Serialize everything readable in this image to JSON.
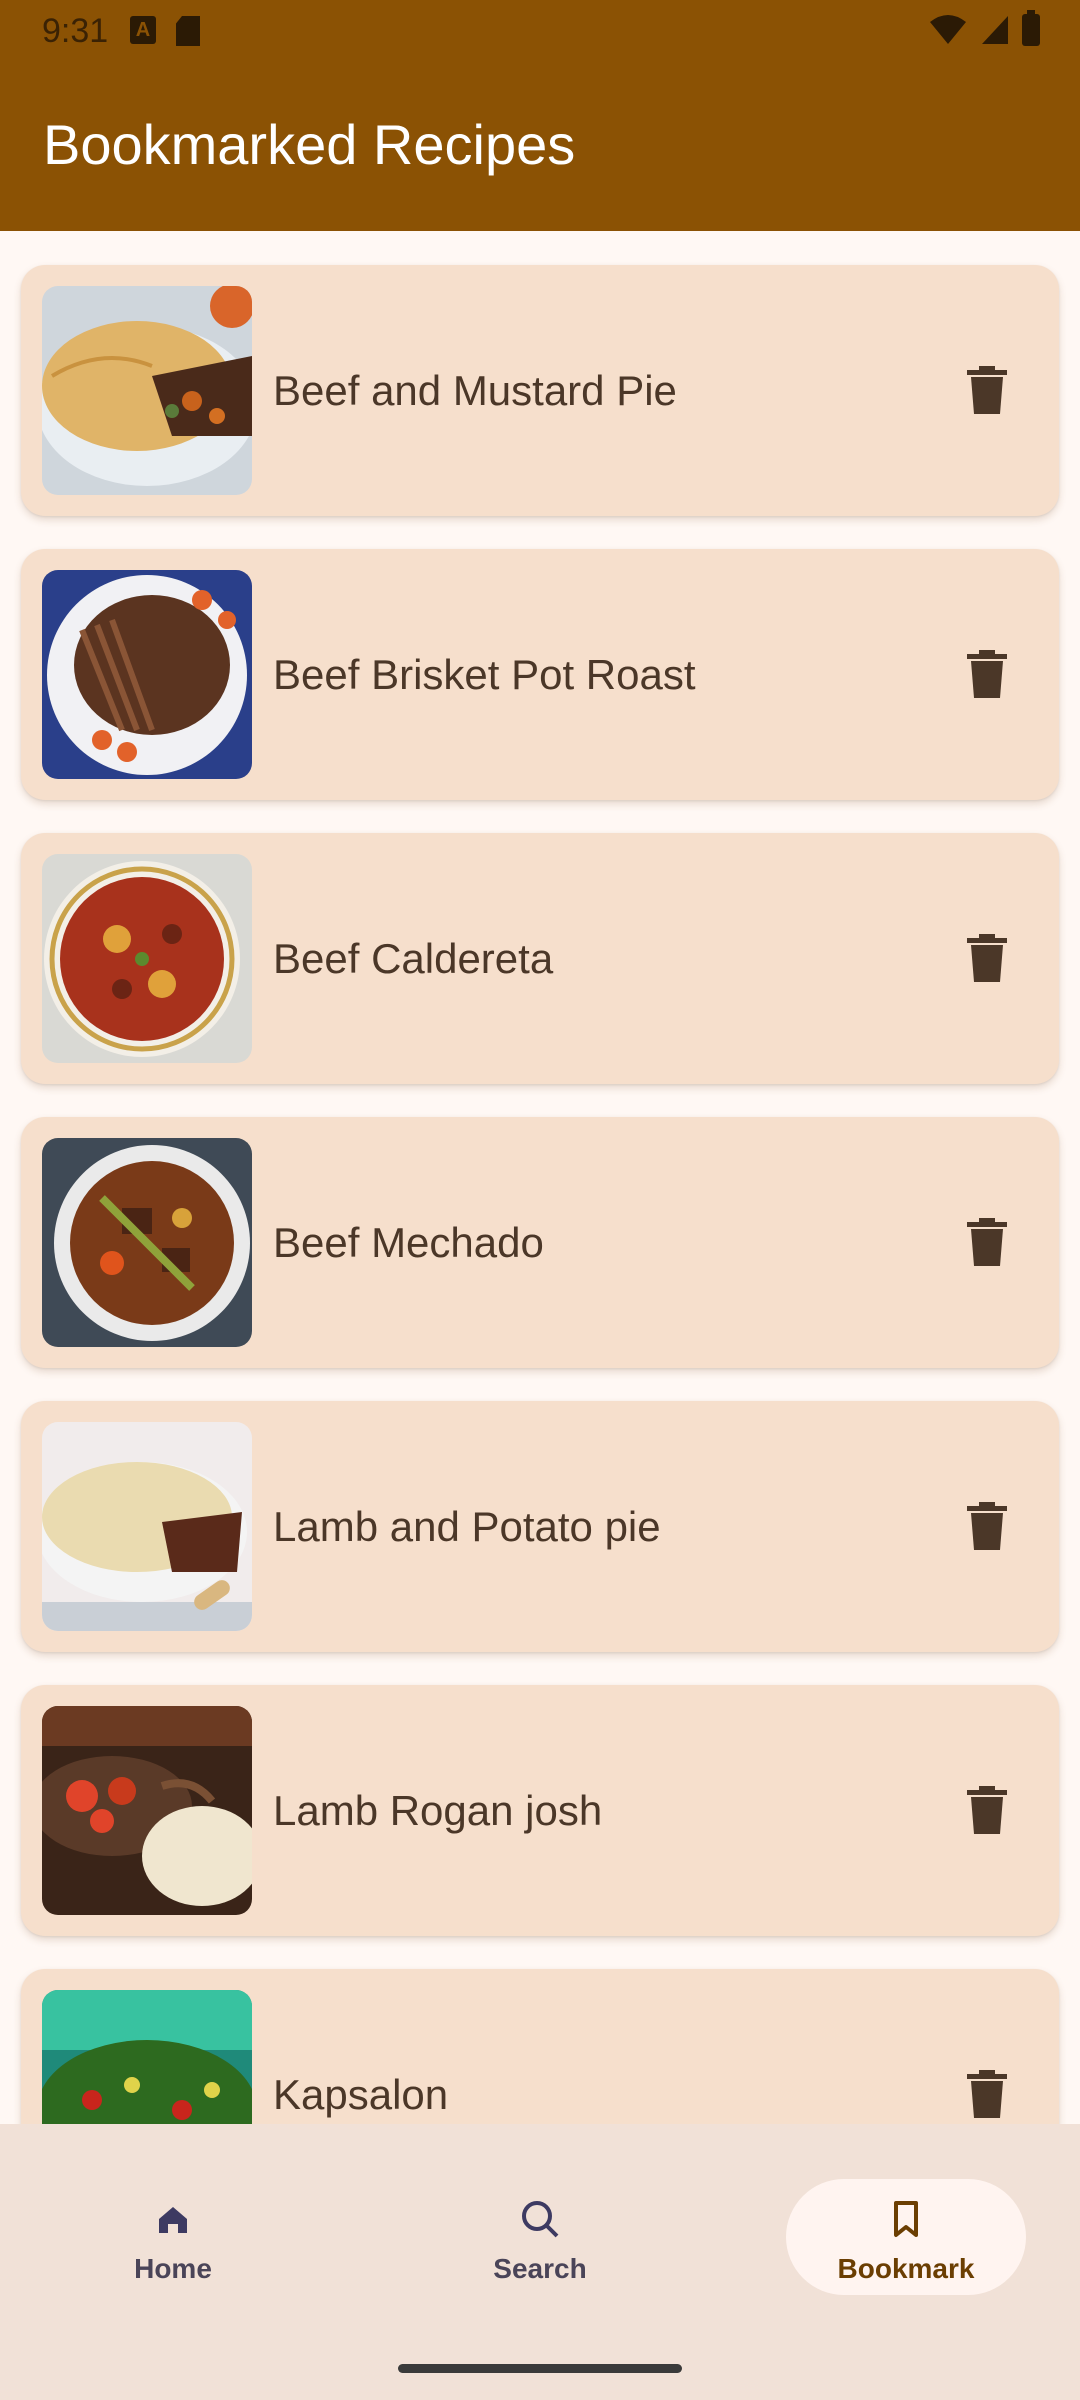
{
  "status_bar": {
    "time": "9:31"
  },
  "header": {
    "title": "Bookmarked Recipes"
  },
  "recipes": [
    {
      "name": "Beef and Mustard Pie"
    },
    {
      "name": "Beef Brisket Pot Roast"
    },
    {
      "name": "Beef Caldereta"
    },
    {
      "name": "Beef Mechado"
    },
    {
      "name": "Lamb and Potato pie"
    },
    {
      "name": "Lamb Rogan josh"
    },
    {
      "name": "Kapsalon"
    }
  ],
  "bottom_nav": {
    "items": [
      {
        "label": "Home",
        "icon": "home-icon"
      },
      {
        "label": "Search",
        "icon": "search-icon"
      },
      {
        "label": "Bookmark",
        "icon": "bookmark-icon",
        "active": true
      }
    ]
  },
  "colors": {
    "app_bar": "#8B5204",
    "card_background": "#F6DFCC",
    "page_background": "#FFF8F4",
    "nav_background": "#F1E1D7"
  }
}
